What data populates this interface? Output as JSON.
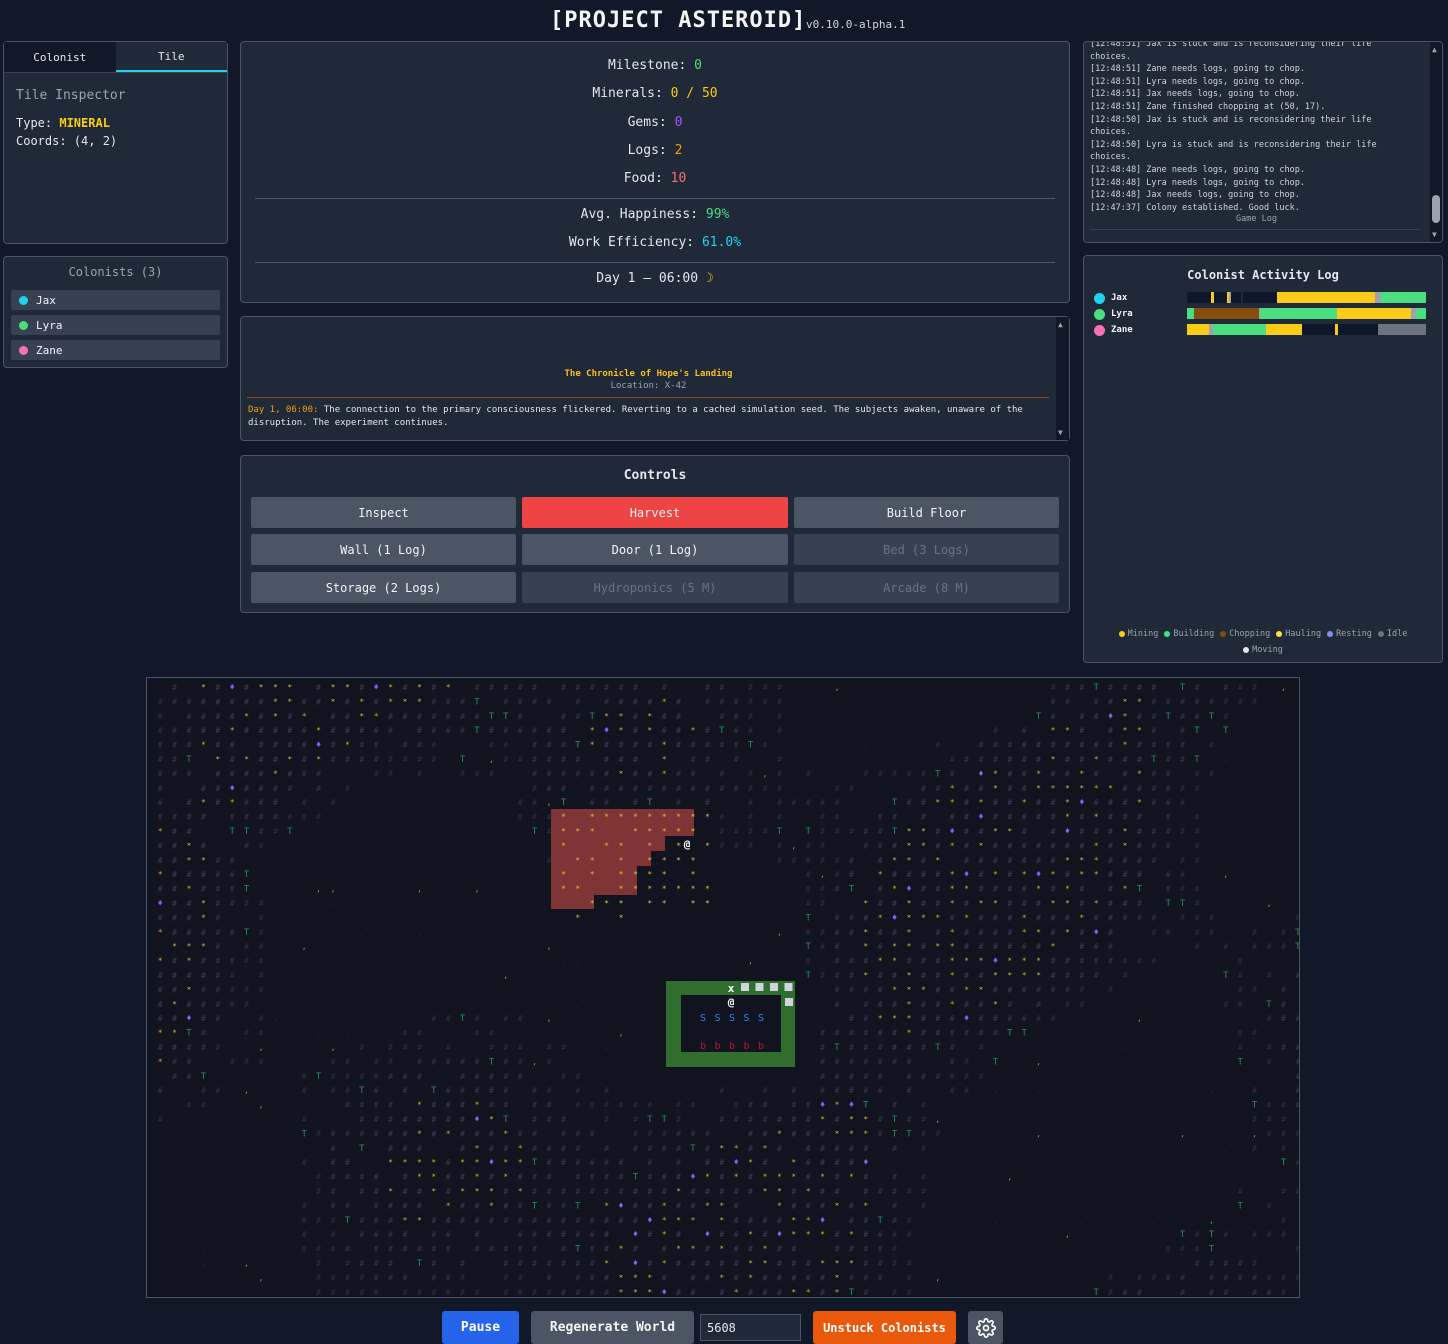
{
  "header": {
    "title": "[PROJECT ASTEROID]",
    "version": "v0.10.0-alpha.1"
  },
  "inspector": {
    "tabs": [
      "Colonist",
      "Tile"
    ],
    "active_tab": "Tile",
    "title": "Tile Inspector",
    "type_label": "Type:",
    "type_value": "MINERAL",
    "coords_label": "Coords:",
    "coords_value": "(4, 2)"
  },
  "colonists": {
    "heading": "Colonists (3)",
    "items": [
      {
        "name": "Jax",
        "color": "#22d3ee"
      },
      {
        "name": "Lyra",
        "color": "#4ade80"
      },
      {
        "name": "Zane",
        "color": "#f472b6"
      }
    ]
  },
  "stats": {
    "milestone_label": "Milestone:",
    "milestone_value": "0",
    "minerals_label": "Minerals:",
    "minerals_value": "0 / 50",
    "gems_label": "Gems:",
    "gems_value": "0",
    "logs_label": "Logs:",
    "logs_value": "2",
    "food_label": "Food:",
    "food_value": "10",
    "happiness_label": "Avg. Happiness:",
    "happiness_value": "99%",
    "efficiency_label": "Work Efficiency:",
    "efficiency_value": "61.0%",
    "day": "Day 1 — 06:00",
    "day_icon": "moon-icon"
  },
  "chronicle": {
    "title": "The Chronicle of Hope's Landing",
    "location": "Location: X-42",
    "entry_time": "Day 1, 06:00:",
    "entry_text": " The connection to the primary consciousness flickered. Reverting to a cached simulation seed. The subjects awaken, unaware of the disruption. The experiment continues."
  },
  "controls": {
    "title": "Controls",
    "buttons": [
      {
        "label": "Inspect",
        "state": "normal"
      },
      {
        "label": "Harvest",
        "state": "active"
      },
      {
        "label": "Build Floor",
        "state": "normal"
      },
      {
        "label": "Wall (1 Log)",
        "state": "normal"
      },
      {
        "label": "Door (1 Log)",
        "state": "normal"
      },
      {
        "label": "Bed (3 Logs)",
        "state": "disabled"
      },
      {
        "label": "Storage (2 Logs)",
        "state": "normal"
      },
      {
        "label": "Hydroponics (5 M)",
        "state": "disabled"
      },
      {
        "label": "Arcade (8 M)",
        "state": "disabled"
      }
    ]
  },
  "game_log": {
    "lines": [
      "[12:48:51] Jax is stuck and is reconsidering their life",
      "choices.",
      "[12:48:51] Zane needs logs, going to chop.",
      "[12:48:51] Lyra needs logs, going to chop.",
      "[12:48:51] Jax needs logs, going to chop.",
      "[12:48:51] Zane finished chopping at (50, 17).",
      "[12:48:50] Jax is stuck and is reconsidering their life",
      "choices.",
      "[12:48:50] Lyra is stuck and is reconsidering their life",
      "choices.",
      "[12:48:48] Zane needs logs, going to chop.",
      "[12:48:48] Lyra needs logs, going to chop.",
      "[12:48:48] Jax needs logs, going to chop.",
      "[12:47:37] Colony established. Good luck."
    ],
    "label": "Game Log"
  },
  "activity": {
    "title": "Colonist Activity Log",
    "rows": [
      {
        "name": "Jax",
        "color": "#22d3ee",
        "segments": [
          {
            "c": "#0f172a",
            "w": 9
          },
          {
            "c": "#facc15",
            "w": 1
          },
          {
            "c": "#0f172a",
            "w": 5
          },
          {
            "c": "#facc15",
            "w": 1
          },
          {
            "c": "#9ca3af",
            "w": 0.5
          },
          {
            "c": "#0f172a",
            "w": 4
          },
          {
            "c": "#1e293b",
            "w": 0.5
          },
          {
            "c": "#0f172a",
            "w": 13
          },
          {
            "c": "#facc15",
            "w": 37
          },
          {
            "c": "#9ca3af",
            "w": 2
          },
          {
            "c": "#4ade80",
            "w": 17
          }
        ]
      },
      {
        "name": "Lyra",
        "color": "#4ade80",
        "segments": [
          {
            "c": "#4ade80",
            "w": 3
          },
          {
            "c": "#854d0e",
            "w": 26
          },
          {
            "c": "#9ca3af",
            "w": 0.5
          },
          {
            "c": "#4ade80",
            "w": 31
          },
          {
            "c": "#facc15",
            "w": 30
          },
          {
            "c": "#9ca3af",
            "w": 2
          },
          {
            "c": "#4ade80",
            "w": 4
          }
        ]
      },
      {
        "name": "Zane",
        "color": "#f472b6",
        "segments": [
          {
            "c": "#facc15",
            "w": 9
          },
          {
            "c": "#9ca3af",
            "w": 2
          },
          {
            "c": "#4ade80",
            "w": 22
          },
          {
            "c": "#facc15",
            "w": 15
          },
          {
            "c": "#0f172a",
            "w": 14
          },
          {
            "c": "#facc15",
            "w": 1
          },
          {
            "c": "#0f172a",
            "w": 17
          },
          {
            "c": "#6b7280",
            "w": 20
          }
        ]
      }
    ],
    "legend": [
      {
        "label": "Mining",
        "color": "#facc15"
      },
      {
        "label": "Building",
        "color": "#4ade80"
      },
      {
        "label": "Chopping",
        "color": "#854d0e"
      },
      {
        "label": "Hauling",
        "color": "#fde047"
      },
      {
        "label": "Resting",
        "color": "#818cf8"
      },
      {
        "label": "Idle",
        "color": "#6b7280"
      },
      {
        "label": "Moving",
        "color": "#e5e7eb"
      }
    ]
  },
  "bottom": {
    "pause_label": "Pause",
    "regen_label": "Regenerate World",
    "seed_value": "5608",
    "unstuck_label": "Unstuck Colonists",
    "settings_icon": "gear-icon"
  },
  "map": {
    "glyph_rock": "#",
    "glyph_mineral": "*",
    "glyph_tree": "T",
    "glyph_gem": "♦",
    "glyph_colonist": "@",
    "glyph_storage": "S",
    "glyph_bed": "b",
    "glyph_marker": "x"
  }
}
